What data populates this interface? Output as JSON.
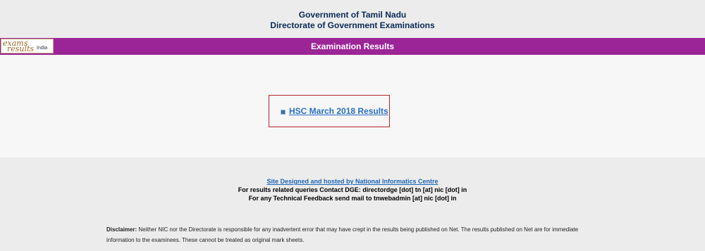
{
  "header": {
    "line1": "Government of Tamil Nadu",
    "line2": "Directorate of Government Examinations"
  },
  "logo": {
    "word1": "exams",
    "word2": "results",
    "word3": "India"
  },
  "banner": {
    "title": "Examination Results"
  },
  "results": {
    "items": [
      {
        "label": "HSC March 2018 Results"
      }
    ]
  },
  "footer": {
    "site_link": "Site Designed and hosted by National Informatics Centre",
    "contact": "For results related queries Contact DGE:  directordge [dot] tn [at] nic [dot] in",
    "feedback": "For any Technical Feedback send mail to tnwebadmin [at] nic [dot] in",
    "disclaimer_label": "Disclaimer:",
    "disclaimer_text": " Neither NIC nor the Directorate is responsible for any inadvertent error that may have crept in the results being published on Net. The results published on Net are for immediate information to the examinees. These cannot be treated as original mark sheets."
  },
  "colors": {
    "banner": "#9b2596",
    "header_text": "#0a2a55",
    "link": "#2a6fc4",
    "box_border": "#b5262a"
  }
}
